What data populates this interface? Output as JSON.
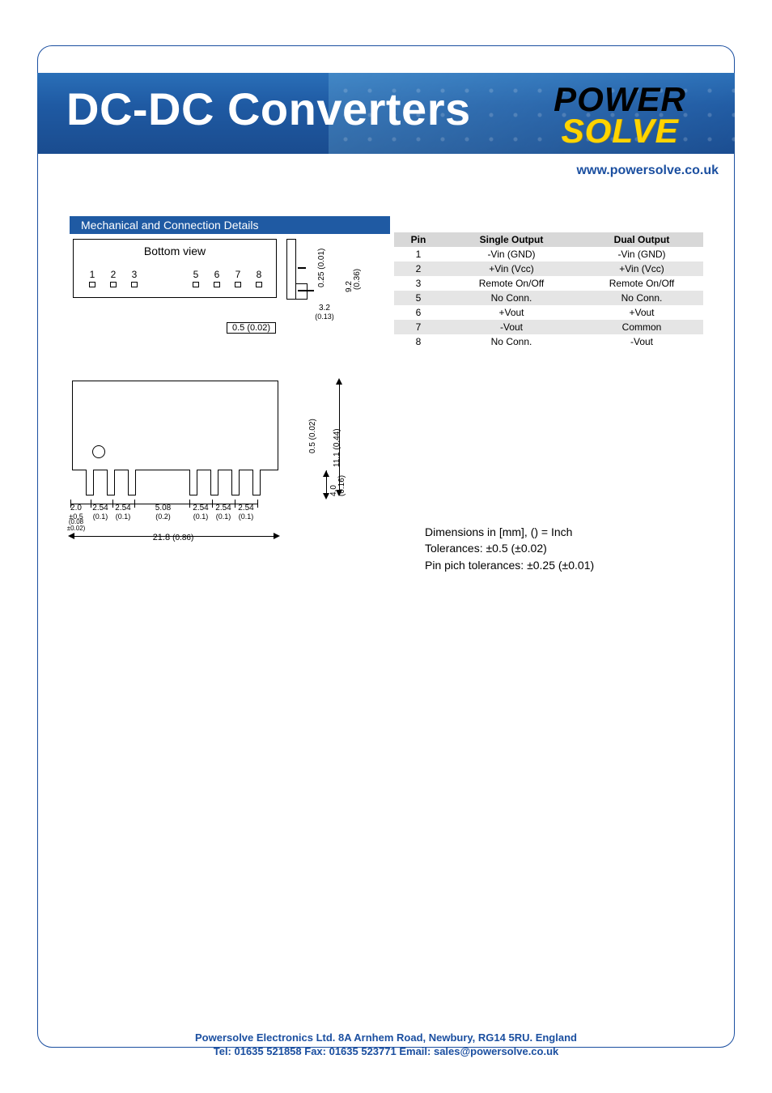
{
  "banner": {
    "title": "DC-DC Converters",
    "logo_top": "POWER",
    "logo_bottom": "SOLVE",
    "url": "www.powersolve.co.uk"
  },
  "section": {
    "title": "Mechanical and Connection Details"
  },
  "pin_table": {
    "headers": {
      "pin": "Pin",
      "single": "Single Output",
      "dual": "Dual Output"
    },
    "rows": [
      {
        "pin": "1",
        "single": "-Vin (GND)",
        "dual": "-Vin (GND)"
      },
      {
        "pin": "2",
        "single": "+Vin (Vcc)",
        "dual": "+Vin (Vcc)"
      },
      {
        "pin": "3",
        "single": "Remote On/Off",
        "dual": "Remote On/Off"
      },
      {
        "pin": "5",
        "single": "No Conn.",
        "dual": "No Conn."
      },
      {
        "pin": "6",
        "single": "+Vout",
        "dual": "+Vout"
      },
      {
        "pin": "7",
        "single": "-Vout",
        "dual": "Common"
      },
      {
        "pin": "8",
        "single": "No Conn.",
        "dual": "-Vout"
      }
    ]
  },
  "drawing_top": {
    "bottom_view": "Bottom view",
    "pins": {
      "1": "1",
      "2": "2",
      "3": "3",
      "5": "5",
      "6": "6",
      "7": "7",
      "8": "8"
    },
    "side": {
      "d025": "0.25 (0.01)",
      "d92": "9.2",
      "d036": "(0.36)",
      "d32": "3.2",
      "d32s": "(0.13)"
    },
    "lead": "0.5 (0.02)"
  },
  "drawing_bot": {
    "dims": {
      "lead": "2.0",
      "lead_tol": "±0.5",
      "lead_in": "(0.08",
      "lead_in2": "±0.02)",
      "p254a": "2.54",
      "p254a_in": "(0.1)",
      "p254b": "2.54",
      "p254b_in": "(0.1)",
      "p508": "5.08",
      "p508_in": "(0.2)",
      "p254c": "2.54",
      "p254c_in": "(0.1)",
      "p254d": "2.54",
      "p254d_in": "(0.1)",
      "p254e": "2.54",
      "p254e_in": "(0.1)",
      "w218": "21.8",
      "w218_in": "(0.86)",
      "h05": "0.5 (0.02)",
      "h111": "11.1 (0.44)",
      "h40": "4.0",
      "h40s": "(0.16)"
    }
  },
  "dim_notes": {
    "l1": "Dimensions in [mm], () = Inch",
    "l2": "Tolerances: ±0.5 (±0.02)",
    "l3": "Pin pich tolerances: ±0.25 (±0.01)"
  },
  "footer": {
    "l1": "Powersolve Electronics Ltd.  8A Arnhem Road,  Newbury, RG14 5RU.  England",
    "l2": "Tel: 01635 521858  Fax: 01635 523771  Email: sales@powersolve.co.uk"
  }
}
